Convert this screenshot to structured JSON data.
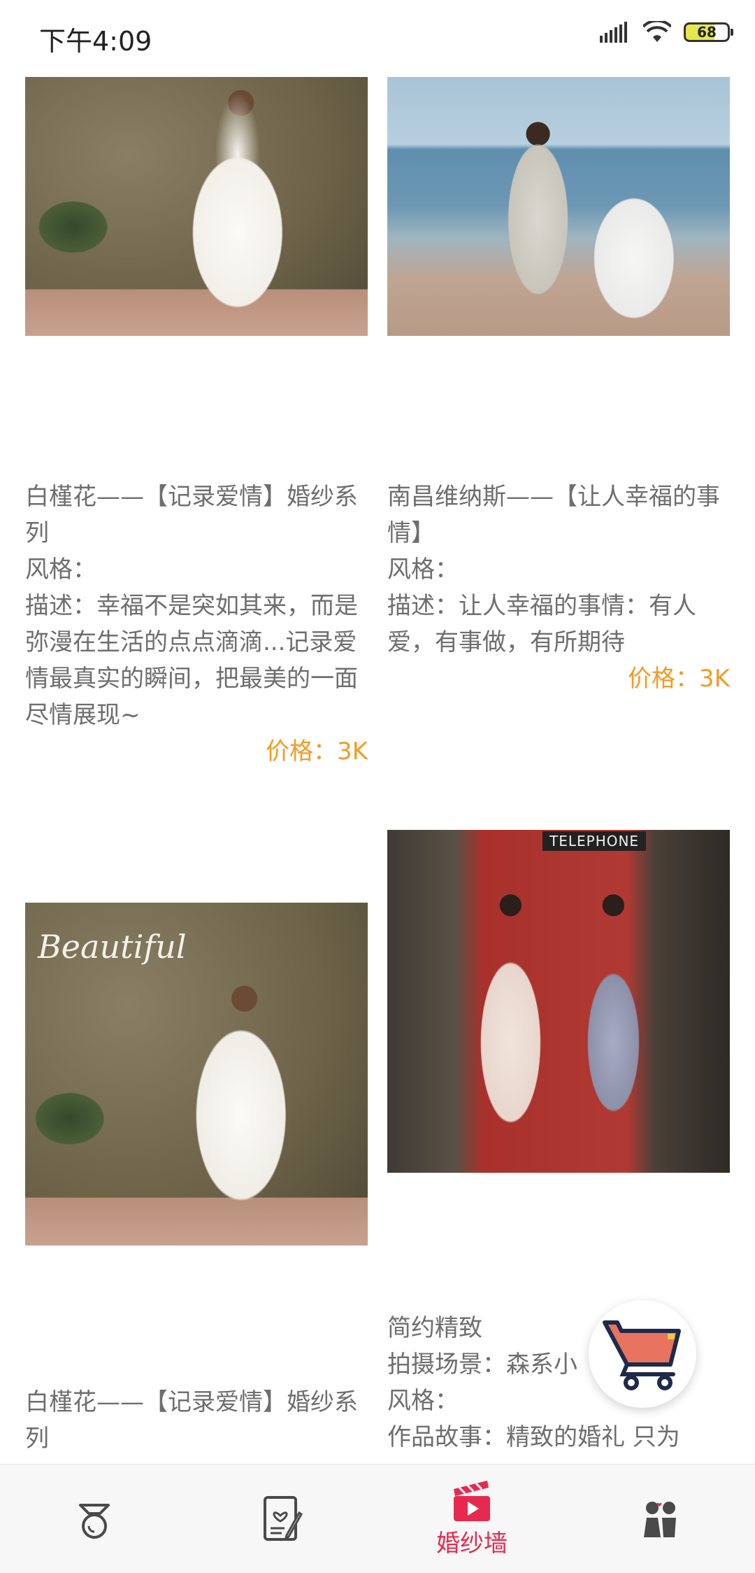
{
  "status_bar": {
    "time": "下午4:09",
    "battery": "68"
  },
  "cards": [
    {
      "title": "白槿花——【记录爱情】婚纱系列",
      "style_label": "风格：",
      "desc": "描述：幸福不是突如其来，而是弥漫在生活的点点滴滴...记录爱情最真实的瞬间，把最美的一面尽情展现~",
      "price": "价格：3K"
    },
    {
      "title": "南昌维纳斯——【让人幸福的事情】",
      "style_label": "风格：",
      "desc": "描述：让人幸福的事情：有人爱，有事做，有所期待",
      "price": "价格：3K"
    },
    {
      "photo_text": "Beautiful",
      "title": "白槿花——【记录爱情】婚纱系列"
    },
    {
      "photo_text": "TELEPHONE",
      "line1": "简约精致",
      "line2": "拍摄场景：森系小",
      "style_label": "风格：",
      "line4": "作品故事：精致的婚礼 只为"
    }
  ],
  "tabbar": {
    "tabs": [
      {
        "icon": "ring-icon",
        "label": ""
      },
      {
        "icon": "notebook-heart-icon",
        "label": ""
      },
      {
        "icon": "video-clapper-icon",
        "label": "婚纱墙"
      },
      {
        "icon": "couple-icon",
        "label": ""
      }
    ],
    "active_color": "#e8294f"
  },
  "colors": {
    "price": "#f39b25",
    "accent": "#e8294f"
  }
}
